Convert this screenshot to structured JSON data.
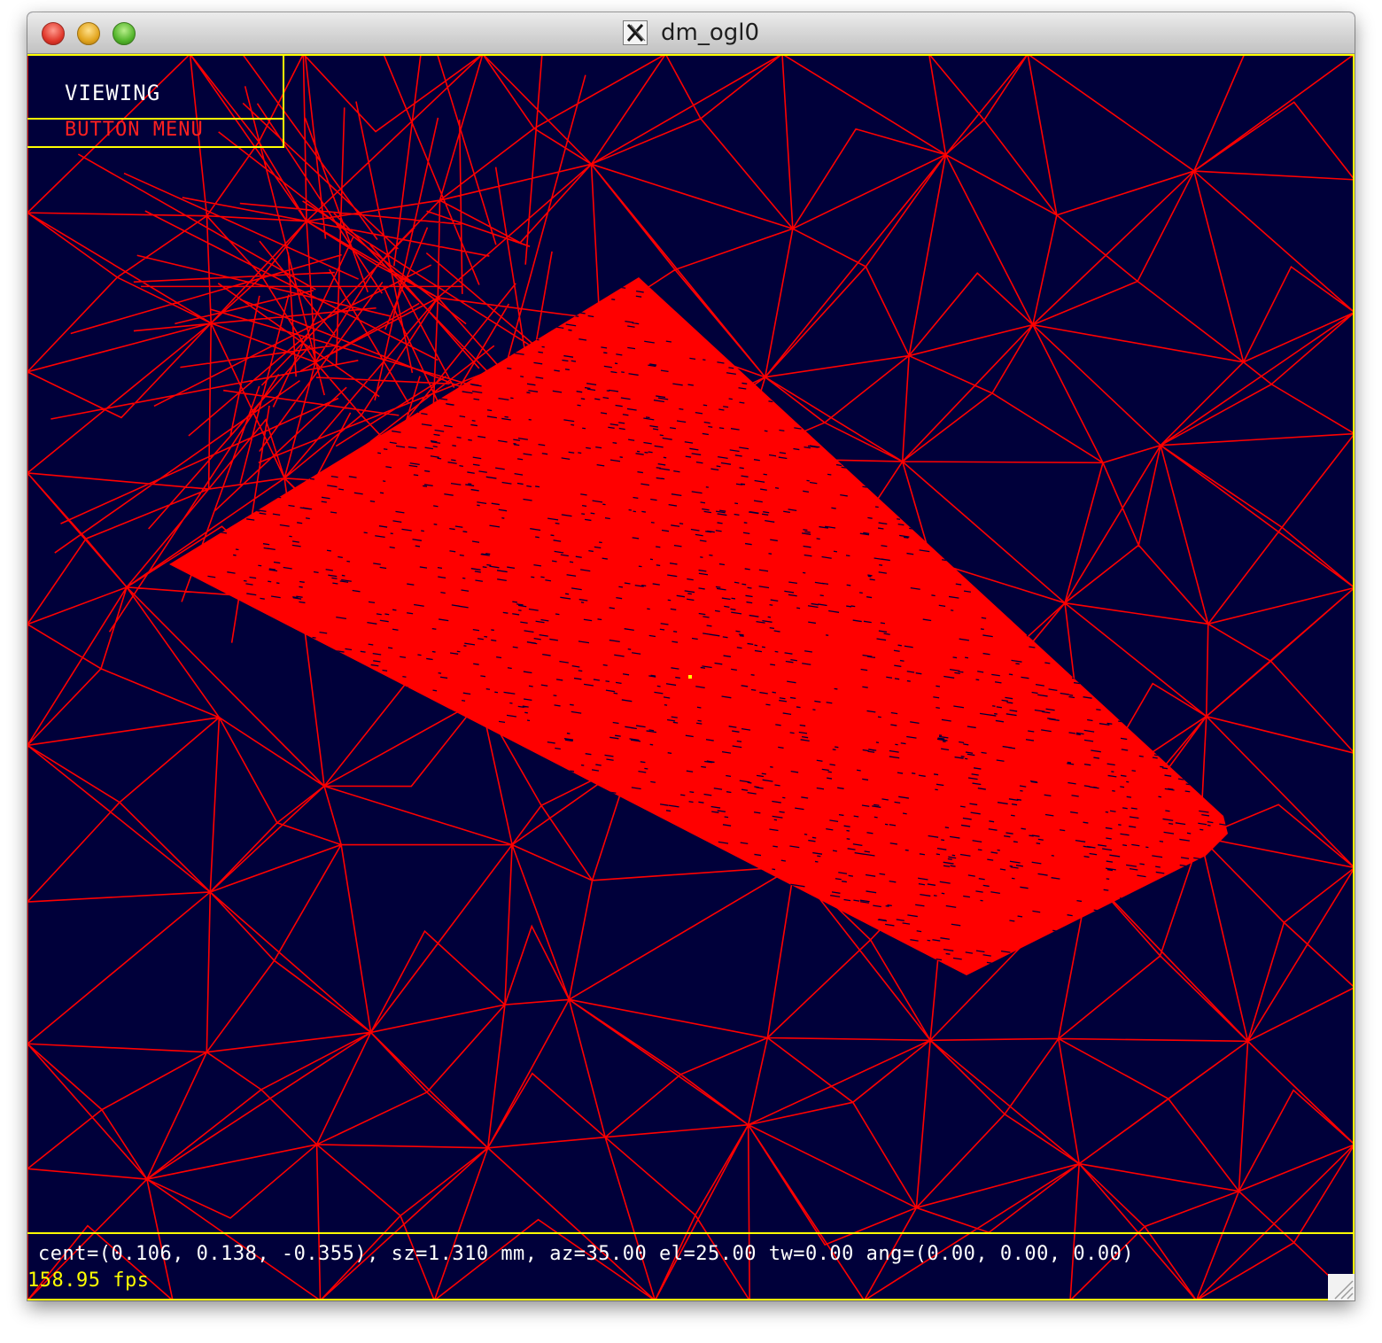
{
  "window": {
    "title": "dm_ogl0",
    "app_icon": "x11-icon"
  },
  "controls": {
    "close": "close-icon",
    "minimize": "minimize-icon",
    "zoom": "zoom-icon"
  },
  "menu": {
    "title": "VIEWING",
    "subtitle": "BUTTON MENU"
  },
  "status": {
    "line": "cent=(0.106, 0.138, -0.355), sz=1.310 mm, az=35.00 el=25.00 tw=0.00 ang=(0.00, 0.00, 0.00)",
    "fps": "158.95 fps"
  },
  "colors": {
    "background": "#00003a",
    "wire": "#ff0000",
    "overlay": "#ffff00",
    "menu_text": "#ffffff",
    "menu_sub_text": "#ff2020"
  }
}
